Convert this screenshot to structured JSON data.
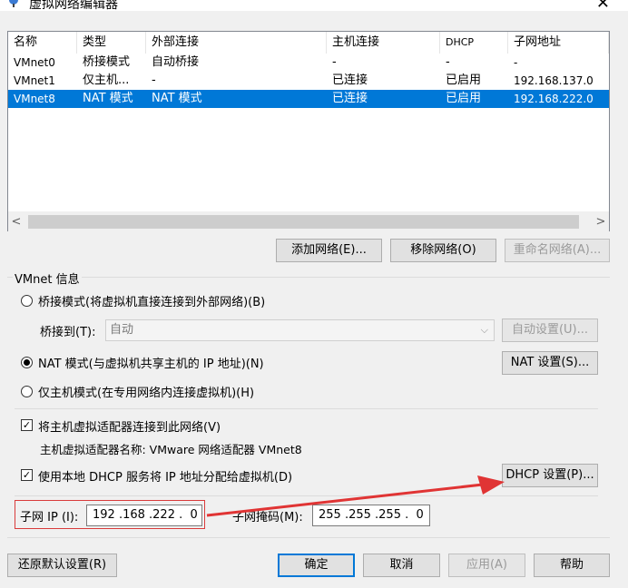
{
  "window": {
    "title": "虚拟网络编辑器",
    "close_glyph": "✕"
  },
  "network_list": {
    "columns": [
      "名称",
      "类型",
      "外部连接",
      "主机连接",
      "DHCP",
      "子网地址"
    ],
    "rows": [
      {
        "name": "VMnet0",
        "type": "桥接模式",
        "external": "自动桥接",
        "host": "-",
        "dhcp": "-",
        "subnet": "-",
        "selected": false
      },
      {
        "name": "VMnet1",
        "type": "仅主机...",
        "external": "-",
        "host": "已连接",
        "dhcp": "已启用",
        "subnet": "192.168.137.0",
        "selected": false
      },
      {
        "name": "VMnet8",
        "type": "NAT 模式",
        "external": "NAT 模式",
        "host": "已连接",
        "dhcp": "已启用",
        "subnet": "192.168.222.0",
        "selected": true
      }
    ],
    "scroll_left_glyph": "<",
    "scroll_right_glyph": ">"
  },
  "list_buttons": {
    "add": "添加网络(E)...",
    "remove": "移除网络(O)",
    "rename": "重命名网络(A)..."
  },
  "vmnet_info": {
    "group_label": "VMnet 信息",
    "bridged_radio": "桥接模式(将虚拟机直接连接到外部网络)(B)",
    "bridged_to_label": "桥接到(T):",
    "bridged_to_value": "自动",
    "auto_settings": "自动设置(U)...",
    "nat_radio": "NAT 模式(与虚拟机共享主机的 IP 地址)(N)",
    "nat_settings": "NAT 设置(S)...",
    "hostonly_radio": "仅主机模式(在专用网络内连接虚拟机)(H)",
    "connect_adapter_check": "将主机虚拟适配器连接到此网络(V)",
    "adapter_name_label": "主机虚拟适配器名称: VMware 网络适配器 VMnet8",
    "dhcp_check": "使用本地 DHCP 服务将 IP 地址分配给虚拟机(D)",
    "dhcp_settings": "DHCP 设置(P)...",
    "subnet_ip_label": "子网 IP (I):",
    "subnet_ip_value": "192 .168 .222 .  0",
    "subnet_mask_label": "子网掩码(M):",
    "subnet_mask_value": "255 .255 .255 .  0",
    "check_glyph": "✓"
  },
  "footer_buttons": {
    "restore": "还原默认设置(R)",
    "ok": "确定",
    "cancel": "取消",
    "apply": "应用(A)",
    "help": "帮助"
  },
  "colors": {
    "selection": "#0078d7",
    "annotation": "#e03434"
  }
}
